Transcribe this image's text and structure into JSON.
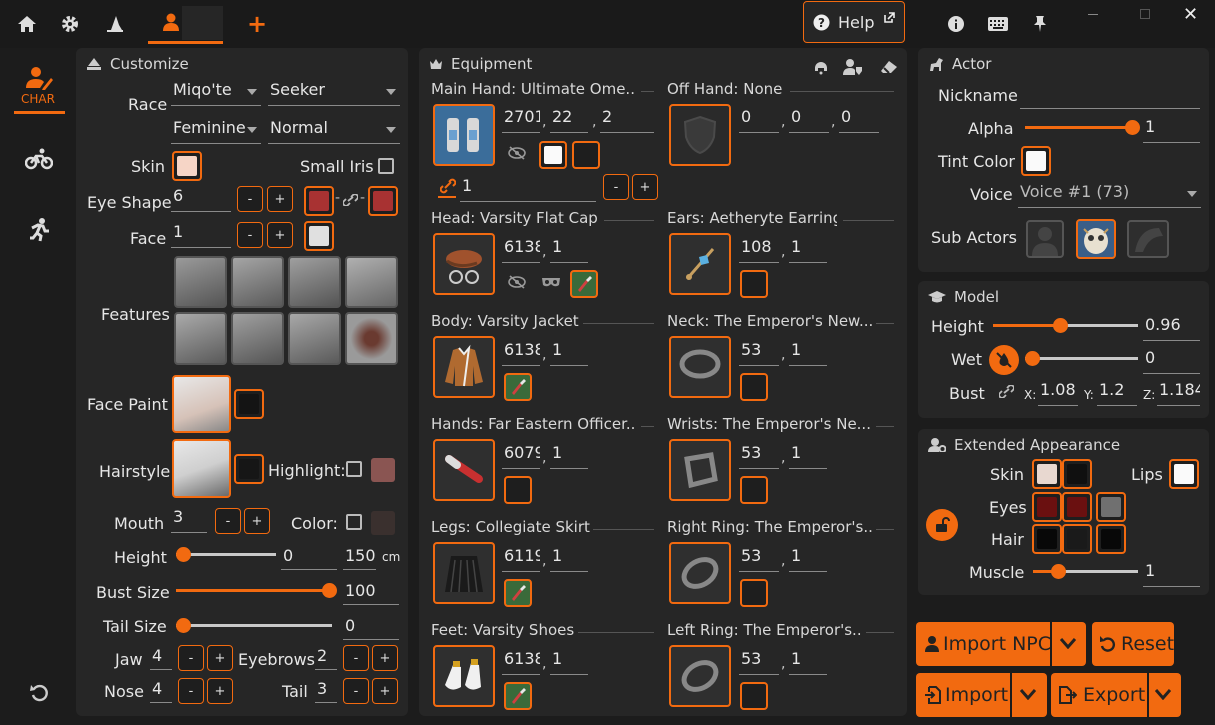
{
  "topbar": {
    "help_label": "Help"
  },
  "nav": {
    "char_label": "CHAR"
  },
  "customize": {
    "title": "Customize",
    "race_label": "Race",
    "race_value": "Miqo'te",
    "clan_value": "Seeker",
    "gender_value": "Feminine",
    "age_value": "Normal",
    "skin_label": "Skin",
    "small_iris_label": "Small Iris",
    "eye_shape_label": "Eye Shape",
    "eye_shape_value": "6",
    "face_label": "Face",
    "face_value": "1",
    "features_label": "Features",
    "face_paint_label": "Face Paint",
    "hairstyle_label": "Hairstyle",
    "highlight_label": "Highlight:",
    "mouth_label": "Mouth",
    "mouth_value": "3",
    "color_label": "Color:",
    "height_label": "Height",
    "height_value": "0",
    "height_cm": "150",
    "cm_label": "cm",
    "height_fraction": 0,
    "bust_label": "Bust Size",
    "bust_value": "100",
    "bust_fraction": 1,
    "tail_size_label": "Tail Size",
    "tail_size_value": "0",
    "tail_fraction": 0,
    "jaw_label": "Jaw",
    "jaw_value": "4",
    "eyebrows_label": "Eyebrows",
    "eyebrows_value": "2",
    "nose_label": "Nose",
    "nose_value": "4",
    "tail_label": "Tail",
    "tail_value": "3",
    "colors": {
      "skin": "#f6d5c6",
      "eye_left": "#a83232",
      "eye_right": "#a83232",
      "face_swatch": "#e0e0e0",
      "face_paint": "#141414",
      "hair": "#161616",
      "highlight": "#8a5552",
      "lip_color": "#3a302e"
    }
  },
  "equipment": {
    "title": "Equipment",
    "main_hand": {
      "label": "Main Hand: Ultimate Ome...",
      "v1": "2701",
      "v2": "22",
      "v3": "2",
      "link_value": "1"
    },
    "off_hand": {
      "label": "Off Hand: None",
      "v1": "0",
      "v2": "0",
      "v3": "0"
    },
    "head": {
      "label": "Head: Varsity Flat Cap",
      "v1": "6138",
      "v2": "1"
    },
    "ears": {
      "label": "Ears: Aetheryte Earring",
      "v1": "108",
      "v2": "1"
    },
    "body": {
      "label": "Body: Varsity Jacket",
      "v1": "6138",
      "v2": "1"
    },
    "neck": {
      "label": "Neck: The Emperor's New...",
      "v1": "53",
      "v2": "1"
    },
    "hands": {
      "label": "Hands: Far Eastern Officer...",
      "v1": "6079",
      "v2": "1"
    },
    "wrists": {
      "label": "Wrists: The Emperor's Ne...",
      "v1": "53",
      "v2": "1"
    },
    "legs": {
      "label": "Legs: Collegiate Skirt",
      "v1": "6119",
      "v2": "1"
    },
    "right_ring": {
      "label": "Right Ring: The Emperor's...",
      "v1": "53",
      "v2": "1"
    },
    "feet": {
      "label": "Feet: Varsity Shoes",
      "v1": "6138",
      "v2": "1"
    },
    "left_ring": {
      "label": "Left Ring: The Emperor's...",
      "v1": "53",
      "v2": "1"
    }
  },
  "actor": {
    "title": "Actor",
    "nickname_label": "Nickname",
    "nickname_value": "",
    "alpha_label": "Alpha",
    "alpha_value": "1",
    "alpha_fraction": 1,
    "tint_label": "Tint Color",
    "voice_label": "Voice",
    "voice_value": "Voice #1 (73)",
    "sub_actors_label": "Sub Actors"
  },
  "model": {
    "title": "Model",
    "height_label": "Height",
    "height_value": "0.96",
    "height_fraction": 0.44,
    "wet_label": "Wet",
    "wet_value": "0",
    "wet_fraction": 0,
    "bust_label": "Bust",
    "x_label": "X:",
    "x_value": "1.08",
    "y_label": "Y:",
    "y_value": "1.2",
    "z_label": "Z:",
    "z_value": "1.184"
  },
  "extended": {
    "title": "Extended Appearance",
    "skin_label": "Skin",
    "lips_label": "Lips",
    "eyes_label": "Eyes",
    "hair_label": "Hair",
    "muscle_label": "Muscle",
    "muscle_value": "1",
    "muscle_fraction": 0.2
  },
  "actions": {
    "import_npc": "Import NPC",
    "reset": "Reset",
    "import": "Import",
    "export": "Export"
  }
}
